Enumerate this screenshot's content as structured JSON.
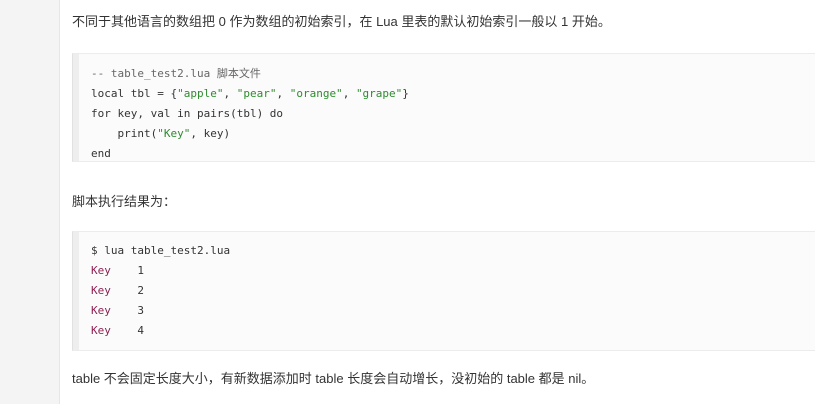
{
  "intro_text": "不同于其他语言的数组把 0 作为数组的初始索引，在 Lua 里表的默认初始索引一般以 1 开始。",
  "code_example": {
    "comment": "-- table_test2.lua 脚本文件",
    "line2_prefix": "local tbl = {",
    "strings": [
      "\"apple\"",
      "\"pear\"",
      "\"orange\"",
      "\"grape\""
    ],
    "line2_suffix": "}",
    "line3": "for key, val in pairs(tbl) do",
    "line4_prefix": "    print(",
    "line4_string": "\"Key\"",
    "line4_suffix": ", key)",
    "line5": "end"
  },
  "result_label": "脚本执行结果为：",
  "output": {
    "command": "$ lua table_test2.lua",
    "rows": [
      {
        "key": "Key",
        "value": "1"
      },
      {
        "key": "Key",
        "value": "2"
      },
      {
        "key": "Key",
        "value": "3"
      },
      {
        "key": "Key",
        "value": "4"
      }
    ]
  },
  "outro_text": "table 不会固定长度大小，有新数据添加时 table 长度会自动增长，没初始的 table 都是 nil。",
  "colors": {
    "string": "#2e8b2e",
    "output_key": "#8b2252"
  }
}
